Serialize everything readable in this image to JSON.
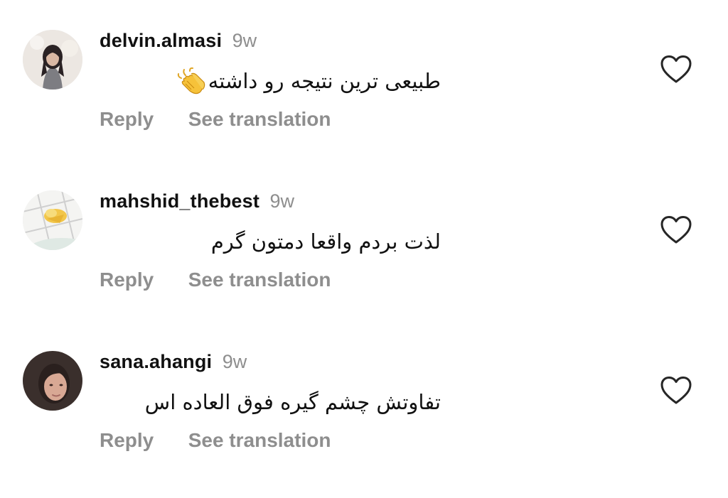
{
  "comments": [
    {
      "username": "delvin.almasi",
      "timestamp": "9w",
      "text": "طبیعی ترین نتیجه رو داشته",
      "emoji": "clapping-hands",
      "reply_label": "Reply",
      "translate_label": "See translation"
    },
    {
      "username": "mahshid_thebest",
      "timestamp": "9w",
      "text": "لذت بردم واقعا دمتون گرم",
      "reply_label": "Reply",
      "translate_label": "See translation"
    },
    {
      "username": "sana.ahangi",
      "timestamp": "9w",
      "text": "تفاوتش چشم گیره فوق العاده اس",
      "reply_label": "Reply",
      "translate_label": "See translation"
    }
  ],
  "colors": {
    "secondary_text": "#8e8e8e",
    "primary_text": "#111111",
    "background": "#ffffff"
  }
}
